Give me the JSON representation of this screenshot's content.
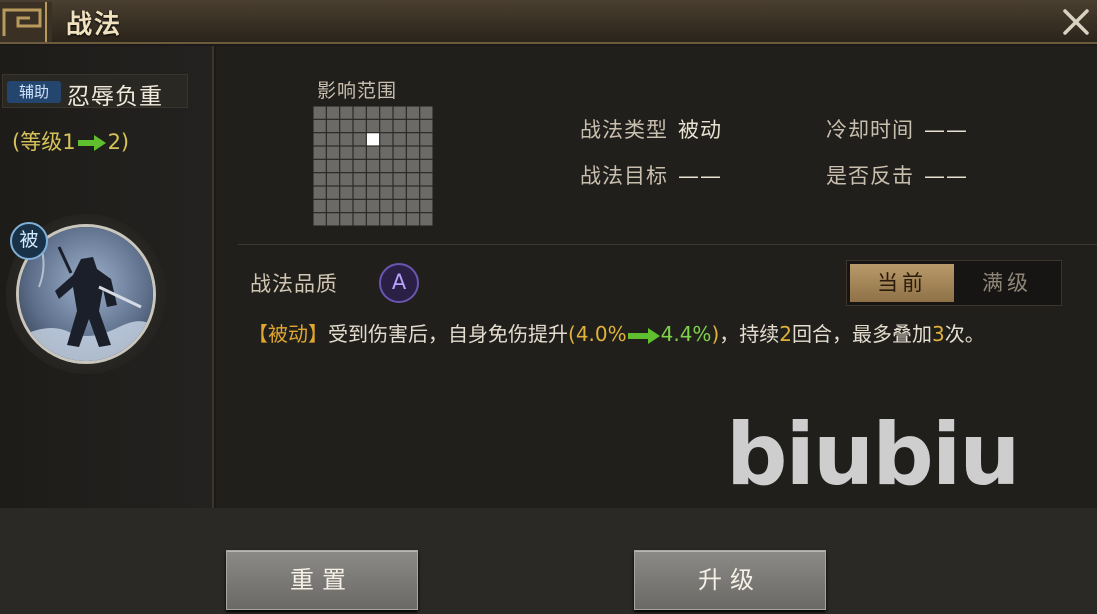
{
  "window": {
    "title": "战法"
  },
  "skill": {
    "role_tag": "辅助",
    "name": "忍辱负重",
    "level_prefix": "(等级1",
    "level_suffix": "2)",
    "passive_badge": "被"
  },
  "range": {
    "label": "影响范围",
    "grid_size": 9,
    "highlight_cell": {
      "row": 2,
      "col": 4
    }
  },
  "info": {
    "type_label": "战法类型",
    "type_value": "被动",
    "cooldown_label": "冷却时间",
    "cooldown_value": "——",
    "target_label": "战法目标",
    "target_value": "——",
    "counter_label": "是否反击",
    "counter_value": "——"
  },
  "quality": {
    "label": "战法品质",
    "grade": "A"
  },
  "toggle": {
    "current": "当前",
    "max": "满级"
  },
  "description": {
    "tag": "【被动】",
    "text1": "受到伤害后，自身免伤提升",
    "open_paren": "(",
    "from": "4.0%",
    "to": "4.4%",
    "close_paren": ")",
    "text2": "，持续",
    "turns": "2",
    "text3": "回合，最多叠加",
    "stacks": "3",
    "text4": "次。"
  },
  "watermark": "biubiu",
  "buttons": {
    "reset": "重置",
    "upgrade": "升级"
  },
  "colors": {
    "accent_gold": "#e0a62e",
    "value_yellow": "#d6c35a",
    "arrow_green": "#5fbf2e",
    "quality_purple": "#6a55b0"
  },
  "icons": [
    "title-ornament-icon",
    "close-icon",
    "arrow-right-icon",
    "passive-badge-icon",
    "portrait-image"
  ]
}
